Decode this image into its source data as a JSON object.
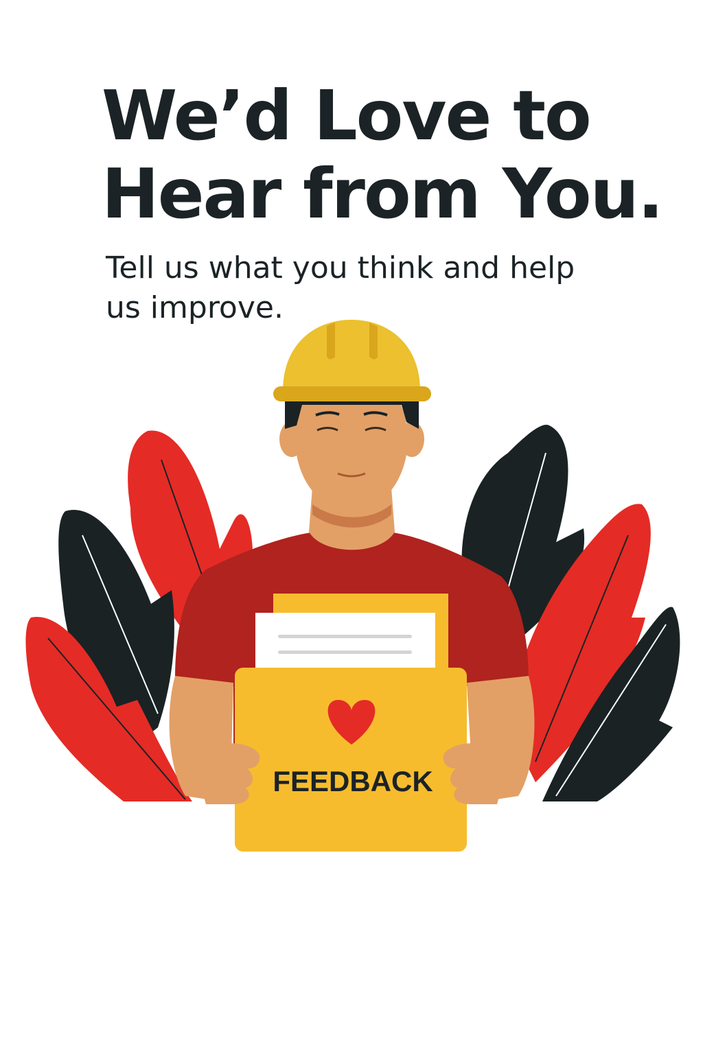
{
  "heading": {
    "line1": "We’d Love to",
    "line2": "Hear from You."
  },
  "subtitle": "Tell us what you think and help us improve.",
  "illustration": {
    "folder_label": "FEEDBACK",
    "icons": [
      "heart-icon",
      "hard-hat-icon",
      "leaf-icon",
      "document-icon"
    ]
  },
  "colors": {
    "text": "#1b2326",
    "leaf_red": "#e52b26",
    "leaf_dark": "#1a2224",
    "hard_hat": "#ecc02e",
    "shirt": "#b0231f",
    "skin": "#e2a066",
    "folder": "#f7bc2e",
    "heart": "#e52b26"
  }
}
